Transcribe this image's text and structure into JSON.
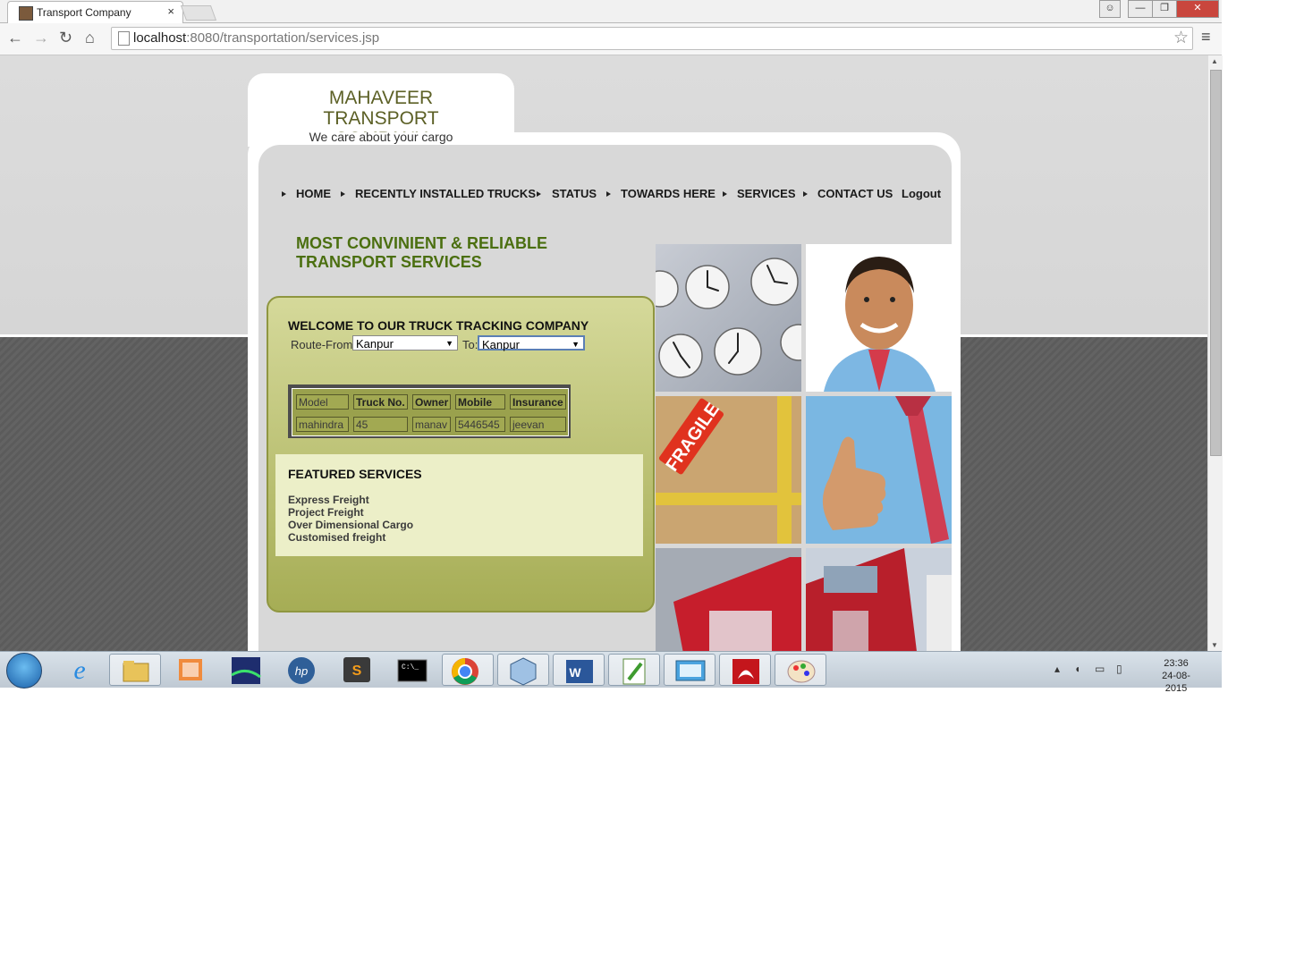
{
  "browser": {
    "tab_title": "Transport Company",
    "tab_close": "×",
    "url_host": "localhost",
    "url_rest": ":8080/transportation/services.jsp",
    "window_buttons": [
      "—",
      "❐",
      "✕"
    ]
  },
  "site": {
    "company_name": "MAHAVEER TRANSPORT COMPANY",
    "tagline": "We care about your cargo",
    "nav": [
      "HOME",
      "RECENTLY INSTALLED TRUCKS",
      "STATUS",
      "TOWARDS HERE",
      "SERVICES",
      "CONTACT US",
      "Logout"
    ],
    "headline_line1": "MOST CONVINIENT & RELIABLE",
    "headline_line2": "TRANSPORT SERVICES"
  },
  "tracking": {
    "title": "WELCOME TO OUR TRUCK TRACKING COMPANY",
    "route_from_label": "Route-From:",
    "route_from_value": "Kanpur",
    "route_to_label": "To:",
    "route_to_value": "Kanpur",
    "table_headers": [
      "Model",
      "Truck No.",
      "Owner",
      "Mobile",
      "Insurance"
    ],
    "table_row": [
      "mahindra",
      "45",
      "manav",
      "5446545",
      "jeevan"
    ]
  },
  "featured": {
    "title": "FEATURED SERVICES",
    "items": [
      "Express Freight",
      "Project Freight",
      "Over Dimensional Cargo",
      "Customised freight"
    ]
  },
  "gallery": {
    "fragile_label": "FRAGILE"
  },
  "taskbar": {
    "time": "23:36",
    "date": "24-08-2015",
    "apps": [
      "internet-explorer",
      "file-explorer",
      "app-launcher",
      "media-player",
      "hp-tool",
      "sublime-text",
      "command-prompt",
      "chrome",
      "virtualbox",
      "word",
      "notepad-plus-plus",
      "remote-desktop",
      "acrobat-reader",
      "paint"
    ]
  }
}
